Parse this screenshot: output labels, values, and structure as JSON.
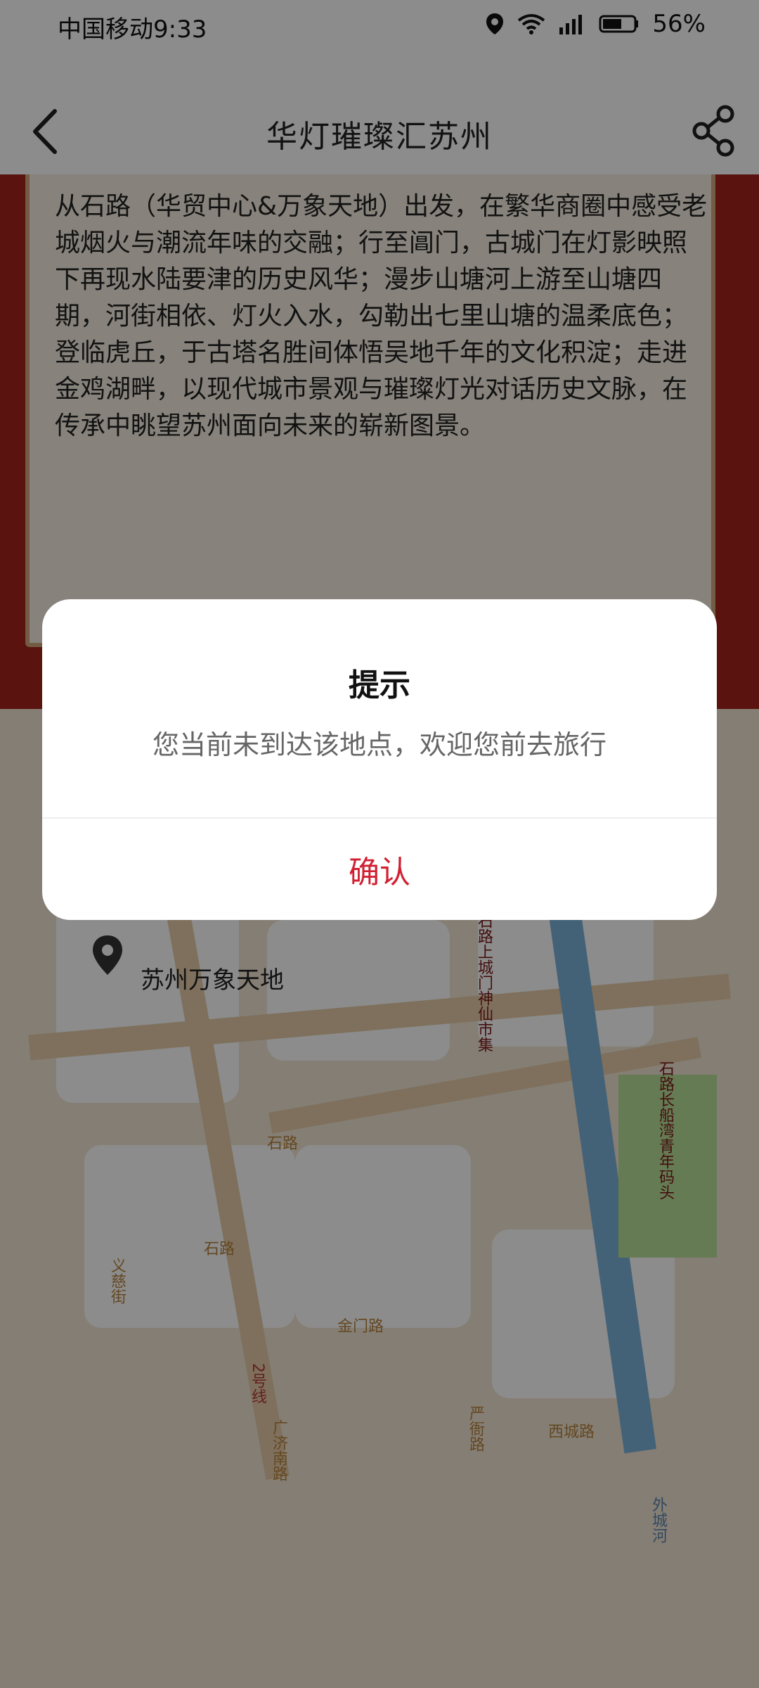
{
  "status_bar": {
    "carrier_time": "中国移动9:33",
    "battery_percent": "56%",
    "icons": [
      "location-icon",
      "wifi-icon",
      "signal-icon",
      "battery-icon"
    ]
  },
  "nav": {
    "title": "华灯璀璨汇苏州",
    "back_icon": "back-arrow-icon",
    "share_icon": "share-icon"
  },
  "article": {
    "intro": "从石路（华贸中心&万象天地）出发，在繁华商圈中感受老城烟火与潮流年味的交融；行至阊门，古城门在灯影映照下再现水陆要津的历史风华；漫步山塘河上游至山塘四期，河街相依、灯火入水，勾勒出七里山塘的温柔底色；登临虎丘，于古塔名胜间体悟吴地千年的文化积淀；走进金鸡湖畔，以现代城市景观与璀璨灯光对话历史文脉，在传承中眺望苏州面向未来的崭新图景。"
  },
  "map": {
    "pin_label": "苏州万象天地",
    "labels": {
      "shilu_station": "石路",
      "shilu_road": "石路",
      "yici_street": "义慈街",
      "jinmen_road": "金门路",
      "line2": "2号线",
      "guangji_road": "广济南路",
      "xicheng_road": "西城路",
      "yanhe_road": "严衙路",
      "waicheng_river": "外城河",
      "shilu_market": "石路上城门神仙市集",
      "shilu_dock": "石路长船湾青年码头"
    }
  },
  "dialog": {
    "title": "提示",
    "message": "您当前未到达该地点，欢迎您前去旅行",
    "confirm_label": "确认"
  },
  "colors": {
    "accent": "#d02032",
    "header_bg": "#ffffff",
    "dim_overlay": "rgba(0,0,0,0.45)"
  }
}
